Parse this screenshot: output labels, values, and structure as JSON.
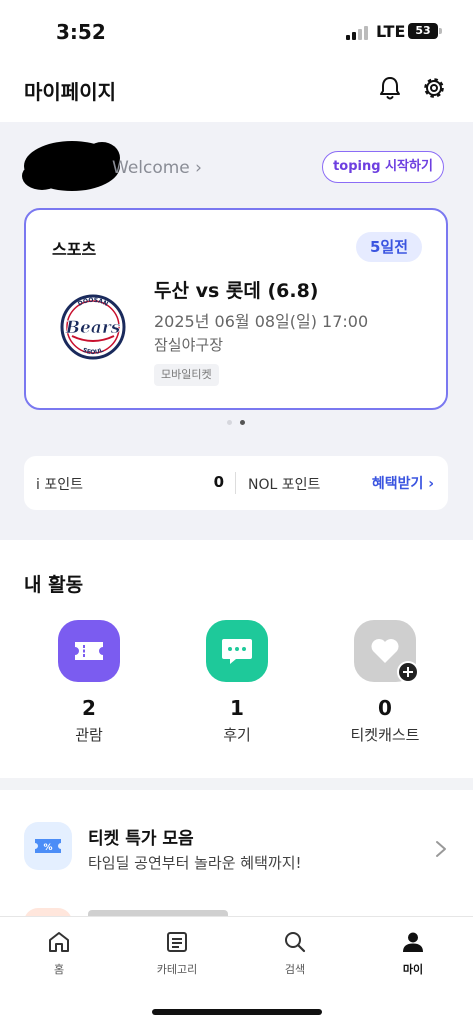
{
  "status_bar": {
    "time": "3:52",
    "network": "LTE",
    "battery": "53"
  },
  "header": {
    "title": "마이페이지",
    "notification_icon": "bell-icon",
    "settings_icon": "gear-icon"
  },
  "profile": {
    "welcome": "Welcome",
    "toping_button": "toping 시작하기"
  },
  "ticket": {
    "category": "스포츠",
    "dday": "5일전",
    "title": "두산 vs 롯데 (6.8)",
    "datetime": "2025년 06월 08일(일) 17:00",
    "venue": "잠실야구장",
    "ticket_type": "모바일티켓",
    "logo_text": "Bears",
    "logo_arc_top": "DOOSAN",
    "logo_arc_bottom": "SEOUL"
  },
  "pager": {
    "count": 2,
    "active_index": 1
  },
  "points": {
    "ipoint_label": "i 포인트",
    "ipoint_value": "0",
    "nol_label": "NOL 포인트",
    "benefit_link": "혜택받기"
  },
  "activity": {
    "title": "내 활동",
    "items": [
      {
        "count": "2",
        "label": "관람",
        "icon": "ticket-icon",
        "color": "#7b5cf0"
      },
      {
        "count": "1",
        "label": "후기",
        "icon": "chat-icon",
        "color": "#1ec99a"
      },
      {
        "count": "0",
        "label": "티켓캐스트",
        "icon": "heart-icon",
        "color": "#cfcfcf"
      }
    ]
  },
  "promo": {
    "title": "티켓 특가 모음",
    "subtitle": "타임딜 공연부터 놀라운 혜택까지!",
    "icon": "coupon-icon"
  },
  "tabs": [
    {
      "label": "홈",
      "icon": "home-icon"
    },
    {
      "label": "카테고리",
      "icon": "list-icon"
    },
    {
      "label": "검색",
      "icon": "search-icon"
    },
    {
      "label": "마이",
      "icon": "person-icon",
      "active": true
    }
  ],
  "colors": {
    "accent_blue": "#3b55e0",
    "toping_purple": "#6d3fe0",
    "card_border": "#7a78f0",
    "section_bg": "#f1f2f7"
  }
}
